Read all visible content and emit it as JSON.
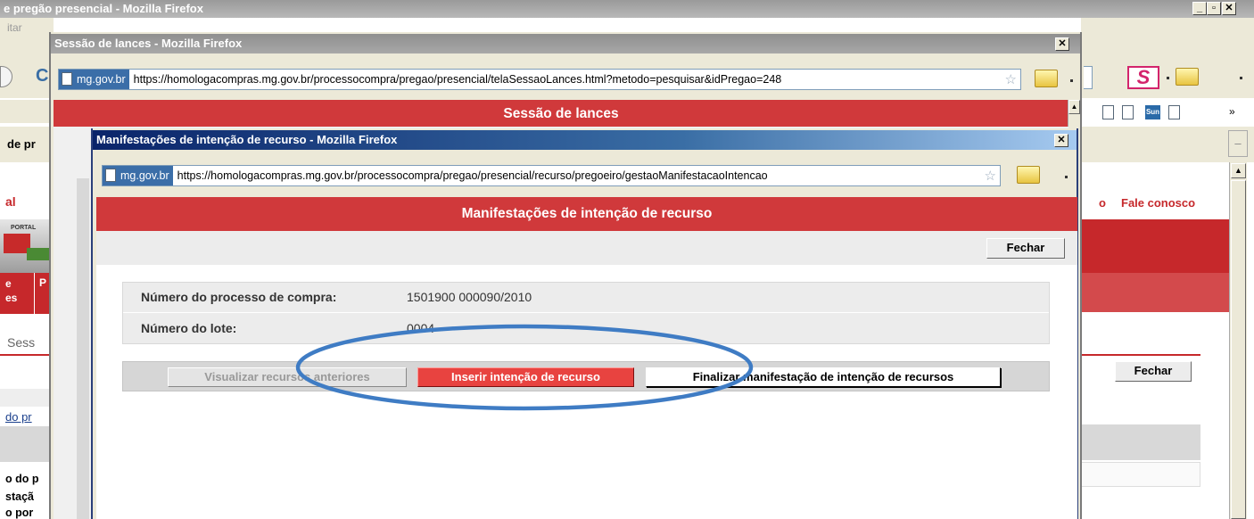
{
  "back_window": {
    "title": "e pregão presencial - Mozilla Firefox",
    "menu_fragment": "itar",
    "tab_fragment": "de pr",
    "portal_fragment": "al",
    "portal_logo_text": "PORTAL",
    "nav_fragment_1": "e\nes",
    "nav_fragment_2": "P",
    "section_fragment": "Sess",
    "link_fragment": "do pr",
    "row1": "o do p",
    "row2": "staçã",
    "row3": "o por",
    "fale_conosco": "Fale conosco",
    "fale_fragment": "o",
    "fechar_label": "Fechar",
    "more_arrows": "»"
  },
  "mid_window": {
    "title": "Sessão de lances - Mozilla Firefox",
    "identity": "mg.gov.br",
    "url": "https://homologacompras.mg.gov.br/processocompra/pregao/presencial/telaSessaoLances.html?metodo=pesquisar&idPregao=248",
    "header": "Sessão de lances"
  },
  "front_window": {
    "title": "Manifestações de intenção de recurso - Mozilla Firefox",
    "identity": "mg.gov.br",
    "url": "https://homologacompras.mg.gov.br/processocompra/pregao/presencial/recurso/pregoeiro/gestaoManifestacaoIntencao",
    "header": "Manifestações de intenção de recurso",
    "fechar_label": "Fechar",
    "fields": [
      {
        "label": "Número do processo de compra:",
        "value": "1501900 000090/2010"
      },
      {
        "label": "Número do lote:",
        "value": "0004"
      }
    ],
    "buttons": {
      "visualizar": "Visualizar recursos anteriores",
      "inserir": "Inserir intenção de recurso",
      "finalizar": "Finalizar manifestação de intenção de recursos"
    }
  },
  "colors": {
    "header_red": "#d0393b",
    "annotation_blue": "#3f7cc4",
    "button_red": "#e84340"
  },
  "icons": [
    "page-icon",
    "star-icon",
    "folder-icon",
    "close-icon",
    "minimize-icon",
    "maximize-icon",
    "s-logo-icon",
    "sun-icon"
  ]
}
